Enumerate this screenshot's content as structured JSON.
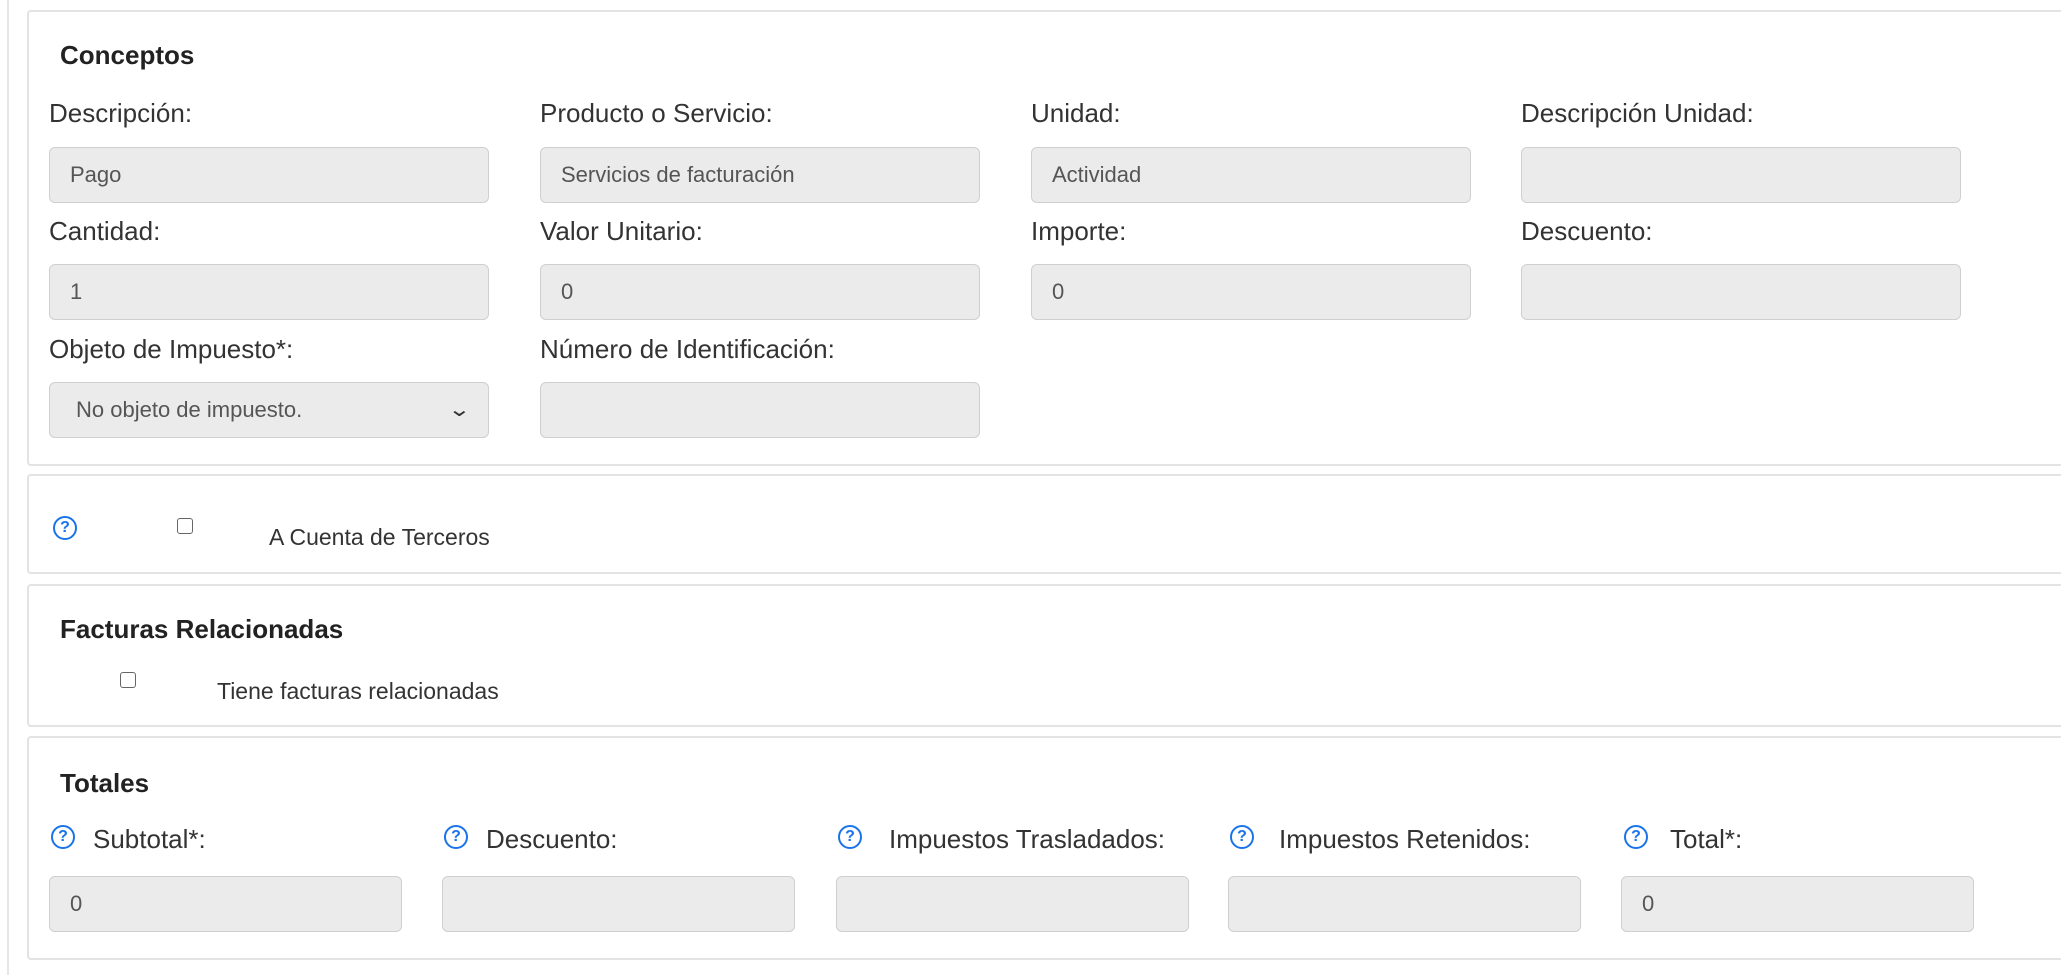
{
  "conceptos": {
    "title": "Conceptos",
    "descripcion": {
      "label": "Descripción:",
      "value": "Pago"
    },
    "producto": {
      "label": "Producto o Servicio:",
      "value": "Servicios de facturación"
    },
    "unidad": {
      "label": "Unidad:",
      "value": "Actividad"
    },
    "descripcion_unidad": {
      "label": "Descripción Unidad:",
      "value": ""
    },
    "cantidad": {
      "label": "Cantidad:",
      "value": "1"
    },
    "valor_unitario": {
      "label": "Valor Unitario:",
      "value": "0"
    },
    "importe": {
      "label": "Importe:",
      "value": "0"
    },
    "descuento": {
      "label": "Descuento:",
      "value": ""
    },
    "objeto_impuesto": {
      "label": "Objeto de Impuesto*:",
      "selected": "No objeto de impuesto."
    },
    "numero_identificacion": {
      "label": "Número de Identificación:",
      "value": ""
    }
  },
  "terceros": {
    "checkbox_label": "A Cuenta de Terceros",
    "checked": false,
    "help_glyph": "?"
  },
  "facturas": {
    "title": "Facturas Relacionadas",
    "checkbox_label": "Tiene facturas relacionadas",
    "checked": false
  },
  "totales": {
    "title": "Totales",
    "help_glyph": "?",
    "subtotal": {
      "label": "Subtotal*:",
      "value": "0"
    },
    "descuento": {
      "label": "Descuento:",
      "value": ""
    },
    "impuestos_trasladados": {
      "label": "Impuestos Trasladados:",
      "value": ""
    },
    "impuestos_retenidos": {
      "label": "Impuestos Retenidos:",
      "value": ""
    },
    "total": {
      "label": "Total*:",
      "value": "0"
    }
  },
  "icons": {
    "help": "help-circle-icon",
    "select_arrow": "chevron-down-icon"
  },
  "colors": {
    "help_icon": "#1a73e8",
    "input_background": "#ebebeb",
    "panel_border": "#e3e3e3"
  }
}
